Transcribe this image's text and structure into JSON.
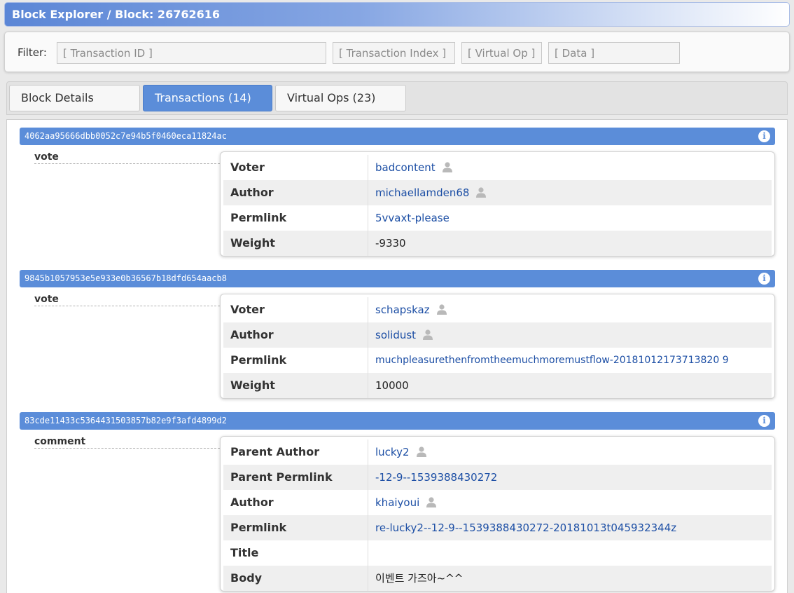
{
  "header": {
    "title": "Block Explorer / Block: 26762616"
  },
  "filter": {
    "label": "Filter:",
    "transaction_id_placeholder": "[ Transaction ID ]",
    "transaction_index_placeholder": "[ Transaction Index ]",
    "virtual_op_placeholder": "[ Virtual Op ]",
    "data_placeholder": "[ Data ]"
  },
  "tabs": [
    {
      "label": "Block Details"
    },
    {
      "label": "Transactions (14)"
    },
    {
      "label": "Virtual Ops (23)"
    }
  ],
  "transactions": [
    {
      "id": "4062aa95666dbb0052c7e94b5f0460eca11824ac",
      "op": "vote",
      "fields": [
        {
          "key": "Voter",
          "value": "badcontent"
        },
        {
          "key": "Author",
          "value": "michaellamden68"
        },
        {
          "key": "Permlink",
          "value": "5vvaxt-please"
        },
        {
          "key": "Weight",
          "value": "-9330"
        }
      ]
    },
    {
      "id": "9845b1057953e5e933e0b36567b18dfd654aacb8",
      "op": "vote",
      "fields": [
        {
          "key": "Voter",
          "value": "schapskaz"
        },
        {
          "key": "Author",
          "value": "solidust"
        },
        {
          "key": "Permlink",
          "value": "muchpleasurethenfromtheemuchmoremustflow-20181012173713820 9"
        },
        {
          "key": "Weight",
          "value": "10000"
        }
      ]
    },
    {
      "id": "83cde11433c5364431503857b82e9f3afd4899d2",
      "op": "comment",
      "fields": [
        {
          "key": "Parent Author",
          "value": "lucky2"
        },
        {
          "key": "Parent Permlink",
          "value": "-12-9--1539388430272"
        },
        {
          "key": "Author",
          "value": "khaiyoui"
        },
        {
          "key": "Permlink",
          "value": "re-lucky2--12-9--1539388430272-20181013t045932344z"
        },
        {
          "key": "Title",
          "value": ""
        },
        {
          "key": "Body",
          "value": "이벤트 가즈아~^^"
        }
      ]
    }
  ],
  "icons": {
    "user": "user-icon",
    "info": "info-icon"
  },
  "colors": {
    "accent": "#5b8dd9",
    "link": "#1d4fa5"
  }
}
